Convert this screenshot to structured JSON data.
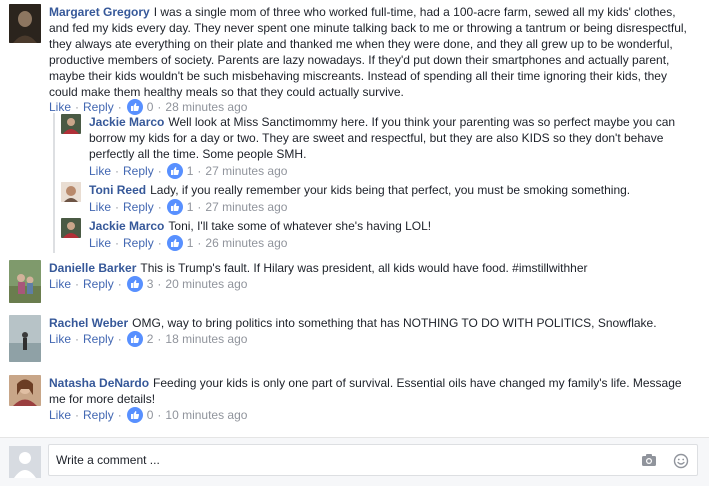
{
  "comments": [
    {
      "author": "Margaret Gregory",
      "text": "I was a single mom of three who worked full-time, had a 100-acre farm, sewed all my kids' clothes, and fed my kids every day. They never spent one minute talking back to me or throwing a tantrum or being disrespectful, they always ate everything on their plate and thanked me when they were done, and they all grew up to be wonderful, productive members of society. Parents are lazy nowadays. If they'd put down their smartphones and actually parent, maybe their kids wouldn't be such misbehaving miscreants. Instead of spending all their time ignoring their kids, they could make them healthy meals so that they could actually survive.",
      "like": "Like",
      "reply": "Reply",
      "likes": "0",
      "time": "28 minutes ago",
      "replies": [
        {
          "author": "Jackie Marco",
          "text": "Well look at Miss Sanctimommy here. If you think your parenting was so perfect maybe you can borrow my kids for a day or two. They are sweet and respectful, but they are also KIDS so they don't behave perfectly all the time. Some people SMH.",
          "like": "Like",
          "reply": "Reply",
          "likes": "1",
          "time": "27 minutes ago"
        },
        {
          "author": "Toni Reed",
          "text": "Lady, if you really remember your kids being that perfect, you must be smoking something.",
          "like": "Like",
          "reply": "Reply",
          "likes": "1",
          "time": "27 minutes ago"
        },
        {
          "author": "Jackie Marco",
          "text": "Toni, I'll take some of whatever she's having LOL!",
          "like": "Like",
          "reply": "Reply",
          "likes": "1",
          "time": "26 minutes ago"
        }
      ]
    },
    {
      "author": "Danielle Barker",
      "text": "This is Trump's fault. If Hilary was president, all kids would have food. #imstillwithher",
      "like": "Like",
      "reply": "Reply",
      "likes": "3",
      "time": "20 minutes ago"
    },
    {
      "author": "Rachel Weber",
      "text": "OMG, way to bring politics into something that has NOTHING TO DO WITH POLITICS, Snowflake.",
      "like": "Like",
      "reply": "Reply",
      "likes": "2",
      "time": "18 minutes ago"
    },
    {
      "author": "Natasha DeNardo",
      "text": "Feeding your kids is only one part of survival. Essential oils have changed my family's life. Message me for more details!",
      "like": "Like",
      "reply": "Reply",
      "likes": "0",
      "time": "10 minutes ago"
    }
  ],
  "composer": {
    "placeholder": "Write a comment ..."
  },
  "icons": {
    "like": "thumbs-up-icon",
    "camera": "camera-icon",
    "emoji": "smiley-icon"
  },
  "colors": {
    "author": "#365899",
    "link": "#4267b2",
    "meta": "#90949c",
    "like_badge": "#5890ff"
  }
}
